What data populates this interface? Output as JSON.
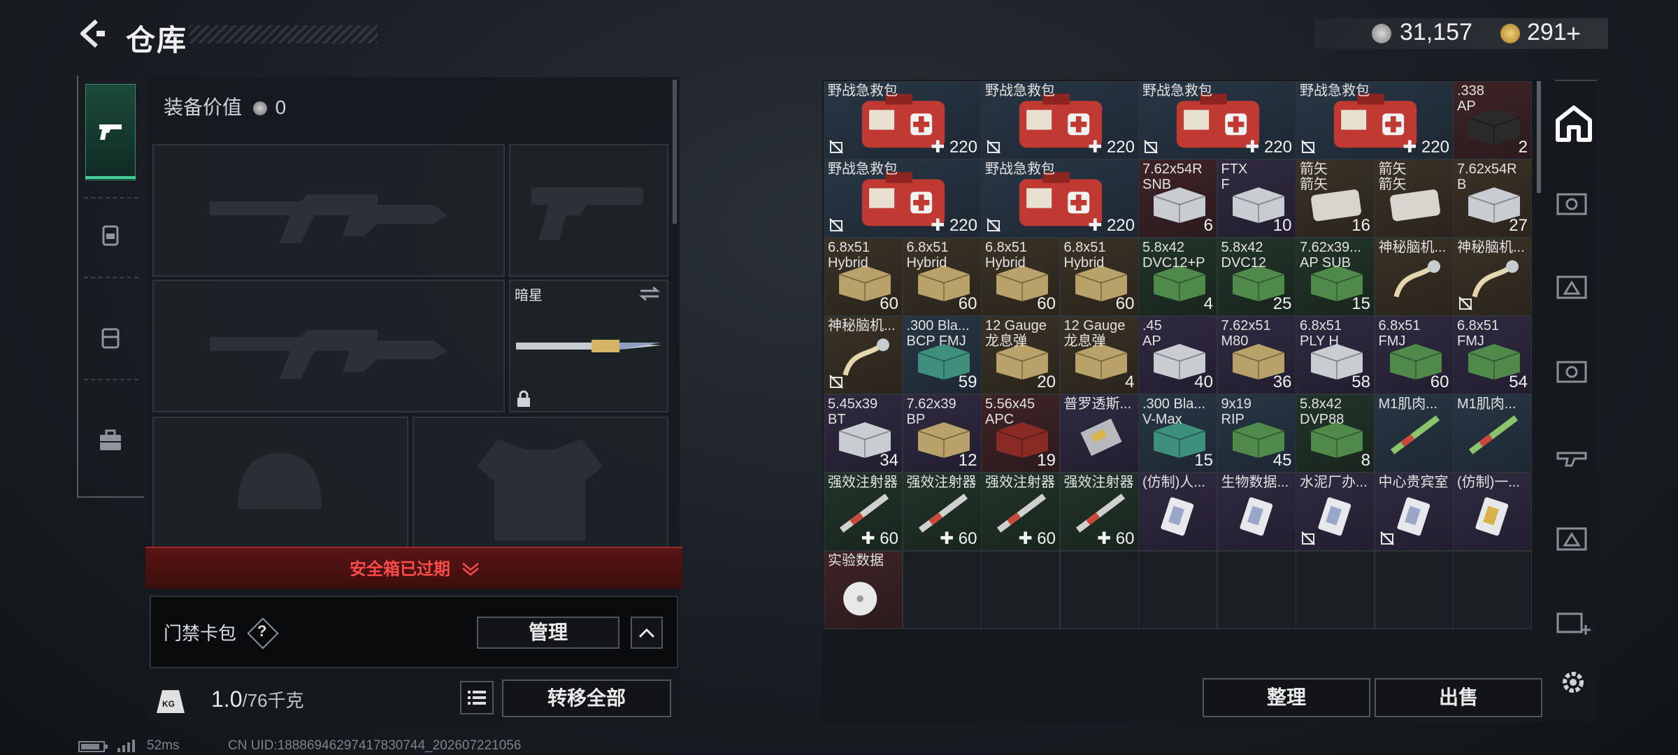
{
  "header": {
    "title": "仓库",
    "currency1": "31,157",
    "currency2": "291",
    "currency2_plus": "+"
  },
  "loadout": {
    "equip_value_label": "装备价值",
    "equip_value": "0",
    "melee_name": "暗星",
    "safe_box_text": "安全箱已过期",
    "card_pack_label": "门禁卡包",
    "card_pack_help": "?",
    "manage_label": "管理",
    "weight_current": "1.0",
    "weight_max": "/76千克",
    "weight_icon_text": "KG",
    "transfer_all_label": "转移全部"
  },
  "inventory": {
    "rows": [
      [
        {
          "name": "野战急救包",
          "count": "220",
          "heal": true,
          "color": "blue",
          "item": "medkit",
          "no_insure": true
        },
        {
          "name": "野战急救包",
          "count": "220",
          "heal": true,
          "color": "blue",
          "item": "medkit",
          "no_insure": true
        },
        {
          "name": "野战急救包",
          "count": "220",
          "heal": true,
          "color": "blue",
          "item": "medkit",
          "no_insure": true
        },
        {
          "name": "野战急救包",
          "count": "220",
          "heal": true,
          "color": "blue",
          "item": "medkit",
          "no_insure": true
        },
        {
          "name": ".338\nAP",
          "count": "2",
          "color": "red",
          "item": "ammo-dark"
        }
      ],
      [
        {
          "name": "野战急救包",
          "count": "220",
          "heal": true,
          "color": "blue",
          "item": "medkit",
          "no_insure": true
        },
        {
          "name": "野战急救包",
          "count": "220",
          "heal": true,
          "color": "blue",
          "item": "medkit",
          "no_insure": true
        },
        {
          "name": "7.62x54R\nSNB",
          "count": "6",
          "color": "red",
          "item": "ammo-white"
        },
        {
          "name": "FTX\nF",
          "count": "10",
          "color": "purple",
          "item": "ammo-white"
        },
        {
          "name": "箭矢\n箭矢",
          "count": "16",
          "color": "brown",
          "item": "tin"
        },
        {
          "name": "箭矢\n箭矢",
          "count": "",
          "color": "brown",
          "item": "tin"
        },
        {
          "name": "7.62x54R\nB",
          "count": "27",
          "color": "brown",
          "item": "ammo-white"
        }
      ],
      [
        {
          "name": "6.8x51\nHybrid",
          "count": "60",
          "color": "brown",
          "item": "ammo-khaki"
        },
        {
          "name": "6.8x51\nHybrid",
          "count": "60",
          "color": "brown",
          "item": "ammo-khaki"
        },
        {
          "name": "6.8x51\nHybrid",
          "count": "60",
          "color": "brown",
          "item": "ammo-khaki"
        },
        {
          "name": "6.8x51\nHybrid",
          "count": "60",
          "color": "brown",
          "item": "ammo-khaki"
        },
        {
          "name": "5.8x42\nDVC12+P",
          "count": "4",
          "color": "green",
          "item": "ammo-green"
        },
        {
          "name": "5.8x42\nDVC12",
          "count": "25",
          "color": "green",
          "item": "ammo-green"
        },
        {
          "name": "7.62x39...\nAP SUB",
          "count": "15",
          "color": "green",
          "item": "ammo-green"
        },
        {
          "name": "神秘脑机...",
          "count": "",
          "color": "brown",
          "item": "cable",
          "no_insure": false
        },
        {
          "name": "神秘脑机...",
          "count": "",
          "color": "brown",
          "item": "cable",
          "no_insure": true
        }
      ],
      [
        {
          "name": "神秘脑机...",
          "count": "",
          "color": "brown",
          "item": "cable",
          "no_insure": true
        },
        {
          "name": ".300 Bla...\nBCP FMJ",
          "count": "59",
          "color": "blue",
          "item": "ammo-teal"
        },
        {
          "name": "12 Gauge\n龙息弹",
          "count": "20",
          "color": "brown",
          "item": "ammo-khaki"
        },
        {
          "name": "12 Gauge\n龙息弹",
          "count": "4",
          "color": "brown",
          "item": "ammo-khaki"
        },
        {
          "name": ".45\nAP",
          "count": "40",
          "color": "purple",
          "item": "ammo-white"
        },
        {
          "name": "7.62x51\nM80",
          "count": "36",
          "color": "purple",
          "item": "ammo-khaki"
        },
        {
          "name": "6.8x51\nPLY H",
          "count": "58",
          "color": "purple",
          "item": "ammo-white"
        },
        {
          "name": "6.8x51\nFMJ",
          "count": "60",
          "color": "purple",
          "item": "ammo-green"
        },
        {
          "name": "6.8x51\nFMJ",
          "count": "54",
          "color": "purple",
          "item": "ammo-green"
        }
      ],
      [
        {
          "name": "5.45x39\nBT",
          "count": "34",
          "color": "purple",
          "item": "ammo-white"
        },
        {
          "name": "7.62x39\nBP",
          "count": "12",
          "color": "purple",
          "item": "ammo-khaki"
        },
        {
          "name": "5.56x45\nAPC",
          "count": "19",
          "color": "red",
          "item": "ammo-red"
        },
        {
          "name": "普罗透斯...",
          "count": "",
          "color": "purple",
          "item": "device"
        },
        {
          "name": ".300 Bla...\nV-Max",
          "count": "15",
          "color": "blue",
          "item": "ammo-teal"
        },
        {
          "name": "9x19\nRIP",
          "count": "45",
          "color": "blue",
          "item": "ammo-green"
        },
        {
          "name": "5.8x42\nDVP88",
          "count": "8",
          "color": "green",
          "item": "ammo-green"
        },
        {
          "name": "M1肌肉...",
          "count": "",
          "color": "blue",
          "item": "syringe-green"
        },
        {
          "name": "M1肌肉...",
          "count": "",
          "color": "blue",
          "item": "syringe-green"
        }
      ],
      [
        {
          "name": "强效注射器",
          "count": "60",
          "heal": true,
          "color": "green",
          "item": "syringe"
        },
        {
          "name": "强效注射器",
          "count": "60",
          "heal": true,
          "color": "green",
          "item": "syringe"
        },
        {
          "name": "强效注射器",
          "count": "60",
          "heal": true,
          "color": "green",
          "item": "syringe"
        },
        {
          "name": "强效注射器",
          "count": "60",
          "heal": true,
          "color": "green",
          "item": "syringe"
        },
        {
          "name": "(仿制)人...",
          "count": "",
          "color": "purple",
          "item": "card"
        },
        {
          "name": "生物数据...",
          "count": "",
          "color": "purple",
          "item": "card"
        },
        {
          "name": "水泥厂办...",
          "count": "",
          "color": "purple",
          "item": "card",
          "no_insure": true
        },
        {
          "name": "中心贵宾室",
          "count": "",
          "color": "purple",
          "item": "card",
          "no_insure": true
        },
        {
          "name": "(仿制)一...",
          "count": "",
          "color": "purple",
          "item": "card-gold"
        }
      ],
      [
        {
          "name": "实验数据",
          "count": "",
          "color": "red",
          "item": "disc"
        }
      ]
    ],
    "sort_label": "整理",
    "sell_label": "出售"
  },
  "status": {
    "ping": "52ms",
    "uid": "CN UID:18886946297417830744_202607221056"
  },
  "colors": {
    "accent_green": "#45d39a",
    "alert_red": "#ff4a4a"
  }
}
